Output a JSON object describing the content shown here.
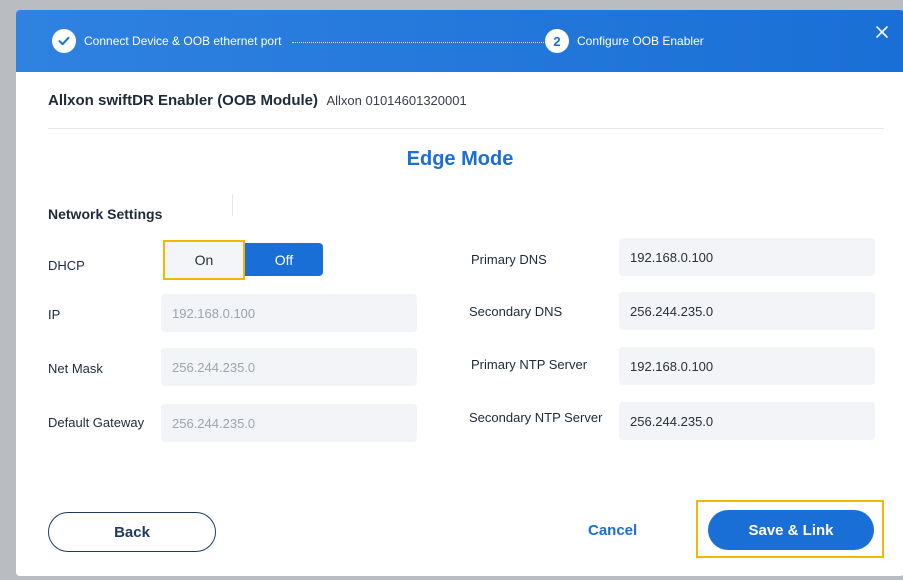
{
  "wizard": {
    "steps": [
      {
        "number": "",
        "label": "Connect Device & OOB ethernet port",
        "state": "done"
      },
      {
        "number": "2",
        "label": "Configure OOB Enabler",
        "state": "active"
      }
    ],
    "close_icon": "close-icon"
  },
  "device": {
    "name": "Allxon swiftDR Enabler (OOB Module)",
    "serial": "Allxon 01014601320001"
  },
  "mode_title": "Edge Mode",
  "network": {
    "section_title": "Network Settings",
    "dhcp": {
      "label": "DHCP",
      "on_label": "On",
      "off_label": "Off",
      "selected": "Off"
    },
    "ip": {
      "label": "IP",
      "value": "192.168.0.100"
    },
    "net_mask": {
      "label": "Net Mask",
      "value": "256.244.235.0"
    },
    "default_gateway": {
      "label": "Default Gateway",
      "value": "256.244.235.0"
    },
    "primary_dns": {
      "label": "Primary DNS",
      "value": "192.168.0.100"
    },
    "secondary_dns": {
      "label": "Secondary DNS",
      "value": "256.244.235.0"
    },
    "primary_ntp": {
      "label": "Primary NTP Server",
      "value": "192.168.0.100"
    },
    "secondary_ntp": {
      "label": "Secondary NTP Server",
      "value": "256.244.235.0"
    }
  },
  "actions": {
    "back_label": "Back",
    "cancel_label": "Cancel",
    "save_label": "Save & Link"
  },
  "colors": {
    "accent": "#1a6fd6",
    "highlight": "#f5b800"
  }
}
